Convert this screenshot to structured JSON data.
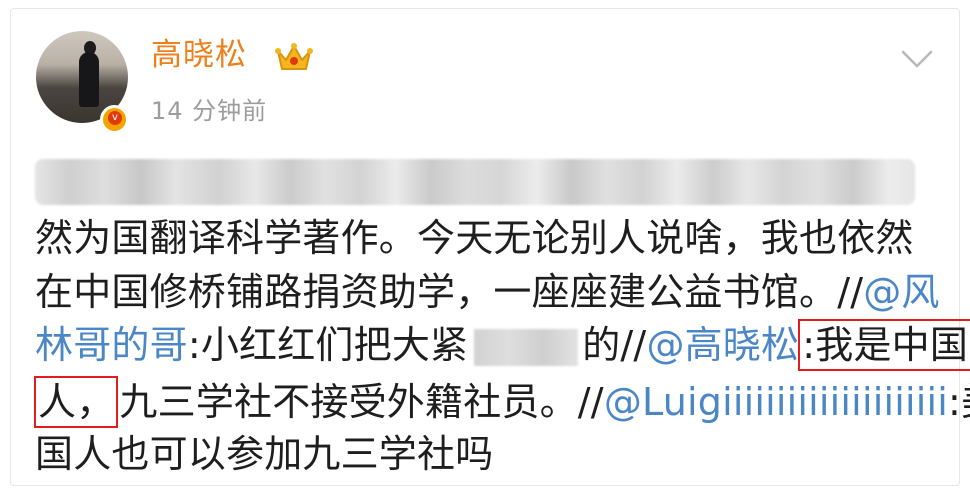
{
  "post": {
    "author": {
      "name": "高晓松",
      "avatar_icon": "profile-avatar",
      "verified_badge_icon": "verified-badge-icon",
      "crown_icon": "crown-icon"
    },
    "timestamp": "14 分钟前",
    "menu_icon": "chevron-down-icon",
    "content": {
      "line_1": "然为国翻译科学著作。今天无论别人说啥，我也依然",
      "line_2_text": "在中国修桥铺路捐资助学，一座座建公益书馆。//",
      "line_2_mention": "@风",
      "line_3_mention": "林哥的哥",
      "line_3_text_1": ":小红红们把大紧",
      "line_3_text_2": "的//",
      "line_3_mention_2": "@高晓松",
      "line_3_highlight": ":我是中国",
      "line_4_highlight": "人，",
      "line_4_text": "九三学社不接受外籍社员。//",
      "line_4_mention": "@Luigiiiiiiiiiiiiiiiiiiiii",
      "line_4_tail": ":美",
      "line_5": "国人也可以参加九三学社吗"
    }
  },
  "colors": {
    "username": "#ee7f1b",
    "timestamp": "#9c9c9c",
    "mention": "#4b87c7",
    "highlight_border": "#e31d1d",
    "verified": "#f5a300"
  }
}
